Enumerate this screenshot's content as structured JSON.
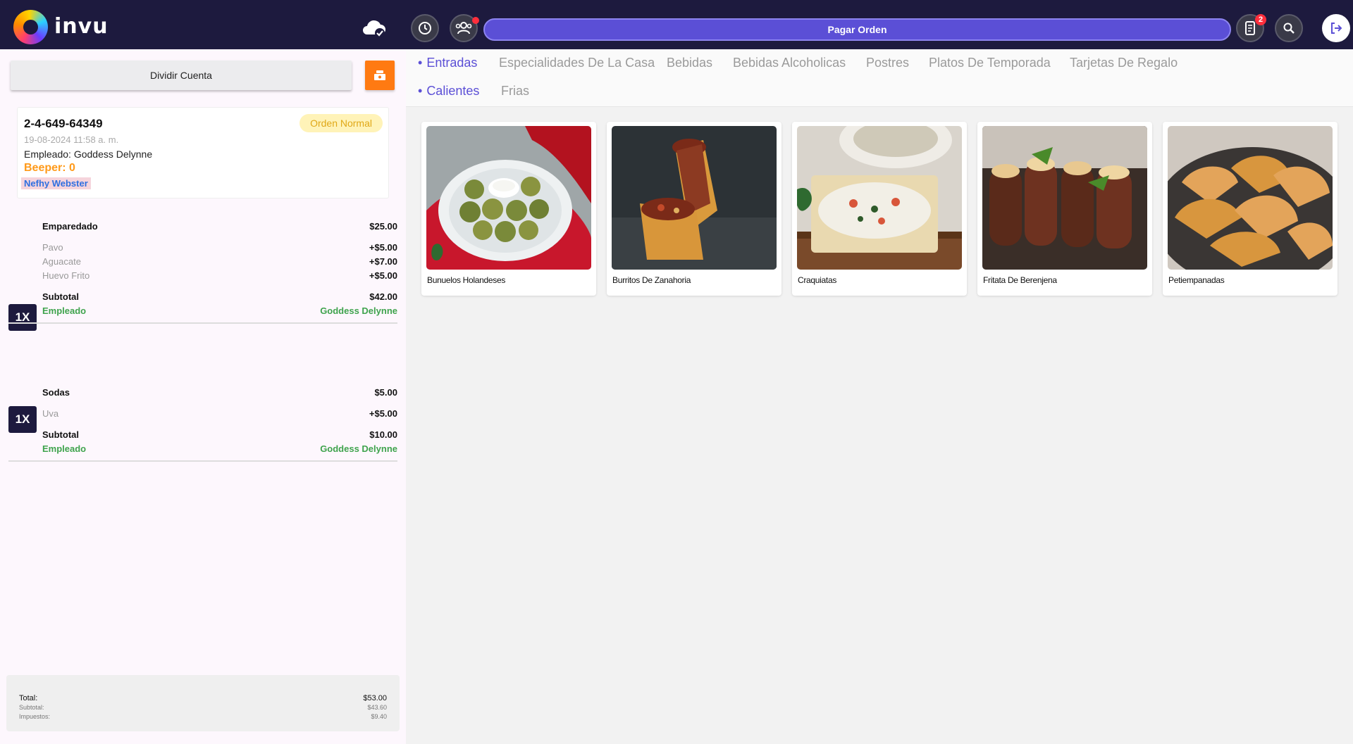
{
  "header": {
    "brand": "invu",
    "pay_label": "Pagar Orden",
    "orders_badge": "2",
    "icons": [
      "cloud-check-icon",
      "clock-icon",
      "users-icon",
      "orders-icon",
      "search-icon",
      "logout-icon"
    ]
  },
  "left": {
    "split_label": "Dividir Cuenta",
    "order": {
      "id": "2-4-649-64349",
      "type": "Orden Normal",
      "date": "19-08-2024 11:58 a. m.",
      "employee_label": "Empleado:",
      "employee": "Goddess Delynne",
      "beeper": "Beeper: 0",
      "client": "Nefhy Webster"
    },
    "items": [
      {
        "qty": "1X",
        "name": "Emparedado",
        "price": "$25.00",
        "modifiers": [
          {
            "name": "Pavo",
            "price": "+$5.00"
          },
          {
            "name": "Aguacate",
            "price": "+$7.00"
          },
          {
            "name": "Huevo Frito",
            "price": "+$5.00"
          }
        ],
        "subtotal_label": "Subtotal",
        "subtotal": "$42.00",
        "emp_label": "Empleado",
        "emp": "Goddess Delynne"
      },
      {
        "qty": "1X",
        "name": "Sodas",
        "price": "$5.00",
        "modifiers": [
          {
            "name": "Uva",
            "price": "+$5.00"
          }
        ],
        "subtotal_label": "Subtotal",
        "subtotal": "$10.00",
        "emp_label": "Empleado",
        "emp": "Goddess Delynne"
      }
    ],
    "totals": {
      "total_label": "Total:",
      "total": "$53.00",
      "subtotal_label": "Subtotal:",
      "subtotal": "$43.60",
      "tax_label": "Impuestos:",
      "tax": "$9.40"
    }
  },
  "categories": {
    "main": [
      "Entradas",
      "Especialidades De La Casa",
      "Bebidas",
      "Bebidas Alcoholicas",
      "Postres",
      "Platos De Temporada",
      "Tarjetas De Regalo"
    ],
    "sub": [
      "Calientes",
      "Frias"
    ]
  },
  "products": [
    {
      "name": "Bunuelos Holandeses"
    },
    {
      "name": "Burritos De Zanahoria"
    },
    {
      "name": "Craquiatas"
    },
    {
      "name": "Fritata De Berenjena"
    },
    {
      "name": "Petiempanadas"
    }
  ],
  "colors": {
    "header_bg": "#1d1a3e",
    "accent": "#5b4fd6",
    "orange": "#ff7a12",
    "green": "#3fa34d",
    "beeper": "#ff9a1a",
    "client": "#2e6fe0"
  }
}
